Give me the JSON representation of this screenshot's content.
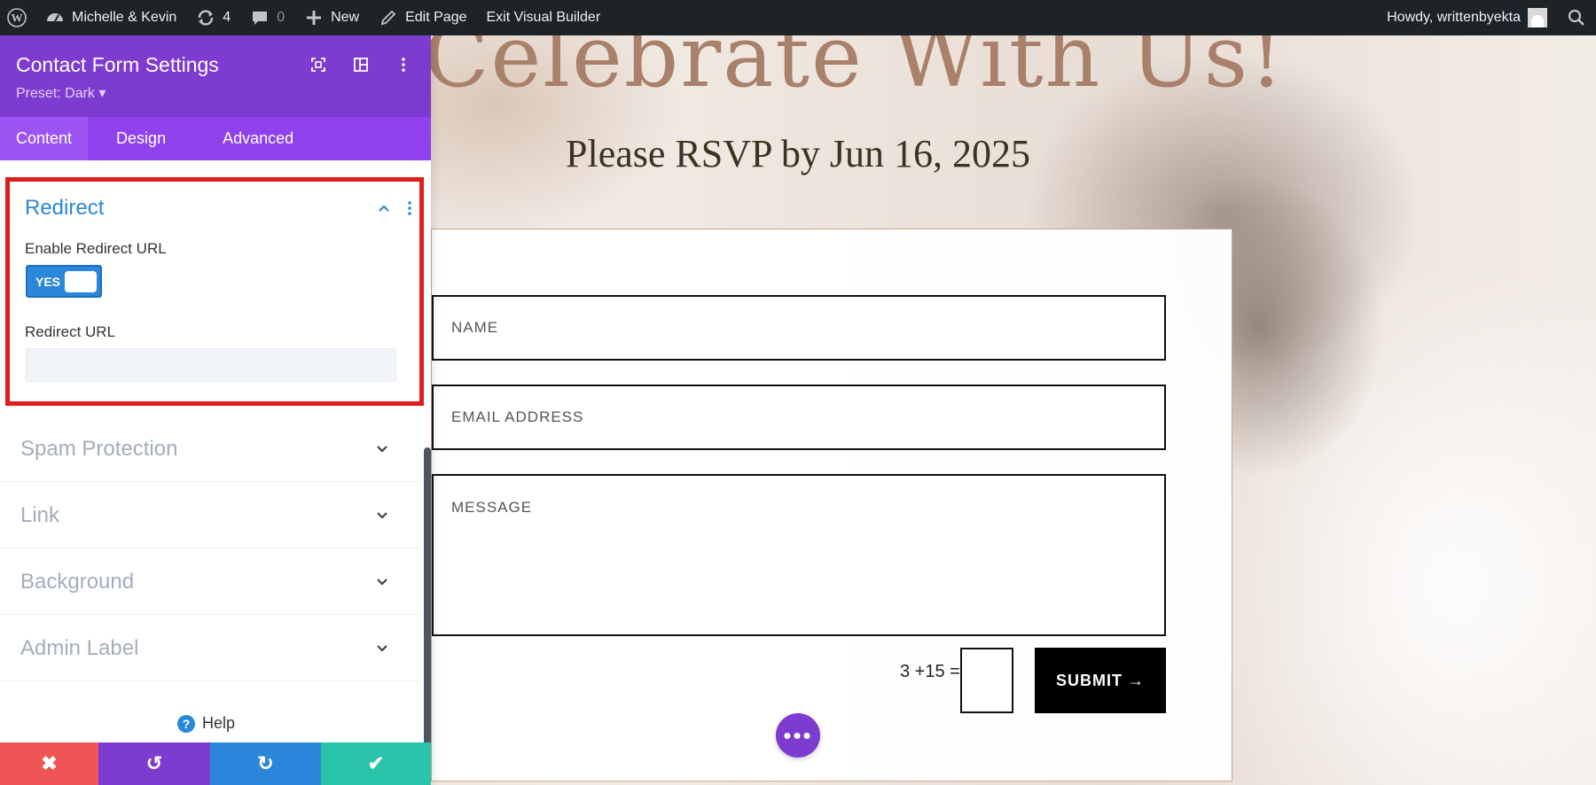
{
  "admin_bar": {
    "site_name": "Michelle & Kevin",
    "updates_count": "4",
    "comments_count": "0",
    "new_label": "New",
    "edit_page_label": "Edit Page",
    "exit_label": "Exit Visual Builder",
    "howdy": "Howdy, writtenbyekta"
  },
  "page": {
    "hero_title": "Celebrate With Us!",
    "rsvp_text": "Please RSVP by Jun 16, 2025",
    "form": {
      "name_placeholder": "NAME",
      "email_placeholder": "EMAIL ADDRESS",
      "message_placeholder": "MESSAGE",
      "captcha_question": "3 +15 =",
      "submit_label": "SUBMIT →"
    },
    "fab_label": "•••"
  },
  "panel": {
    "title": "Contact Form Settings",
    "preset": "Preset: Dark ▾",
    "tabs": [
      {
        "label": "Content",
        "active": true
      },
      {
        "label": "Design",
        "active": false
      },
      {
        "label": "Advanced",
        "active": false
      }
    ],
    "redirect": {
      "title": "Redirect",
      "enable_label": "Enable Redirect URL",
      "toggle_value": "YES",
      "url_label": "Redirect URL",
      "url_value": ""
    },
    "sections": [
      {
        "label": "Spam Protection"
      },
      {
        "label": "Link"
      },
      {
        "label": "Background"
      },
      {
        "label": "Admin Label"
      }
    ],
    "help_label": "Help",
    "footer": {
      "cancel": "✖",
      "undo": "↺",
      "redo": "↻",
      "save": "✔"
    }
  },
  "colors": {
    "panel_purple": "#7e3bd0",
    "tab_purple": "#8f42ec",
    "accent_blue": "#2b87da",
    "highlight_red": "#e01e1e",
    "save_green": "#29c4a9",
    "cancel_red": "#ef5555"
  },
  "icons": [
    "wordpress-icon",
    "dashboard-icon",
    "updates-icon",
    "comments-icon",
    "plus-icon",
    "pencil-icon",
    "search-icon",
    "expand-icon",
    "columns-icon",
    "kebab-icon",
    "chevron-up-icon",
    "chevron-down-icon",
    "help-icon"
  ]
}
